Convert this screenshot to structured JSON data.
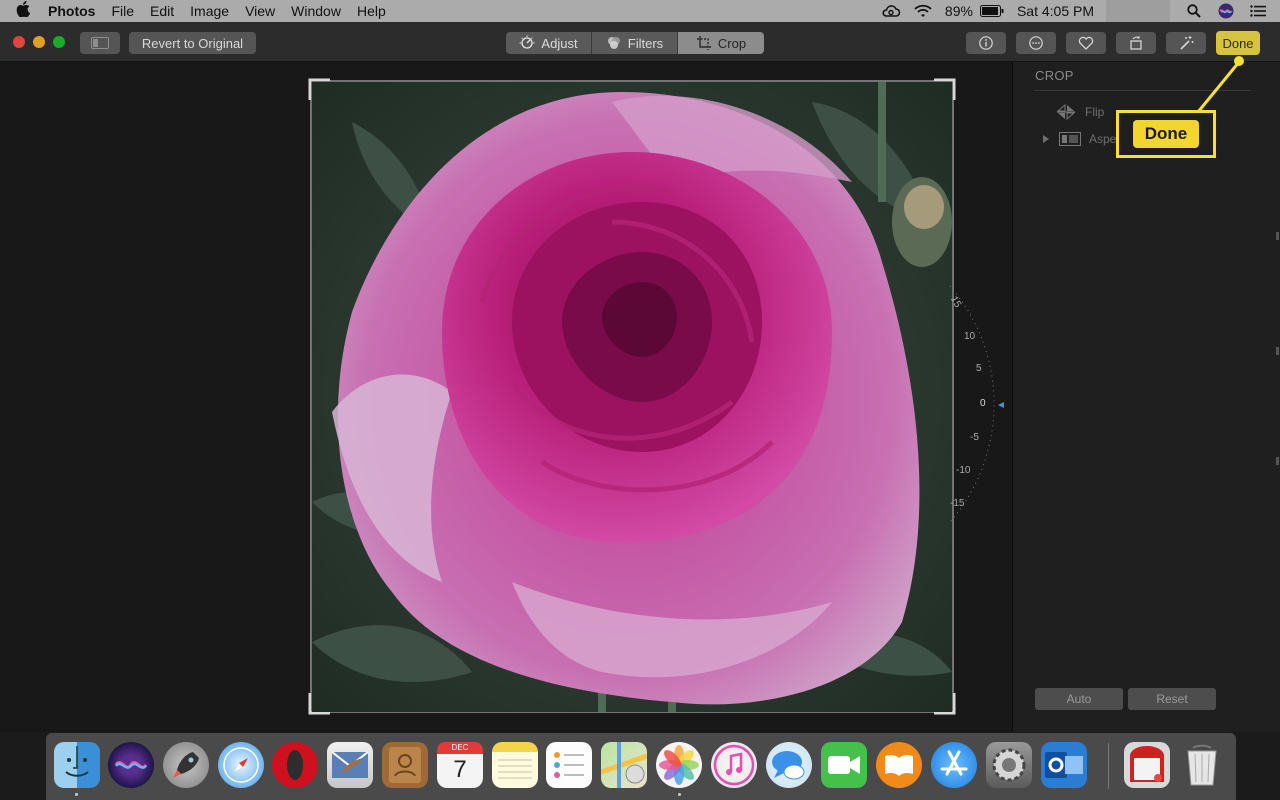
{
  "menubar": {
    "apple_icon": "apple-logo",
    "app_name": "Photos",
    "menus": [
      "File",
      "Edit",
      "Image",
      "View",
      "Window",
      "Help"
    ],
    "battery": "89%",
    "clock": "Sat 4:05 PM",
    "status_icons": [
      "creative-cloud-icon",
      "wifi-icon",
      "battery-icon",
      "search-icon",
      "siri-icon",
      "notification-center-icon"
    ]
  },
  "toolbar": {
    "revert_label": "Revert to Original",
    "segments": [
      {
        "label": "Adjust",
        "icon": "adjust-dial-icon",
        "active": false
      },
      {
        "label": "Filters",
        "icon": "filters-icon",
        "active": false
      },
      {
        "label": "Crop",
        "icon": "crop-icon",
        "active": true
      }
    ],
    "action_icons": [
      "info-icon",
      "more-icon",
      "favorite-heart-icon",
      "rotate-icon",
      "enhance-wand-icon"
    ],
    "done_label": "Done",
    "done_color": "#d8c33e"
  },
  "sidebar": {
    "title": "CROP",
    "flip_label": "Flip",
    "aspect_label": "Aspect",
    "auto_label": "Auto",
    "reset_label": "Reset"
  },
  "rotation_dial": {
    "labels": [
      "15",
      "10",
      "5",
      "0",
      "-5",
      "-10",
      "-15"
    ],
    "current_angle": 0
  },
  "callout": {
    "label": "Done",
    "color": "#f7df33"
  },
  "dock": {
    "apps": [
      "finder",
      "siri",
      "launchpad",
      "safari",
      "opera",
      "mail",
      "contacts",
      "calendar",
      "notes",
      "reminders",
      "maps",
      "photos",
      "itunes",
      "messages",
      "facetime",
      "ibooks",
      "app-store",
      "system-preferences",
      "outlook"
    ],
    "running": [
      "finder",
      "photos"
    ],
    "calendar_month": "DEC",
    "calendar_day": "7",
    "trash_items": [
      "downloads",
      "trash"
    ]
  }
}
